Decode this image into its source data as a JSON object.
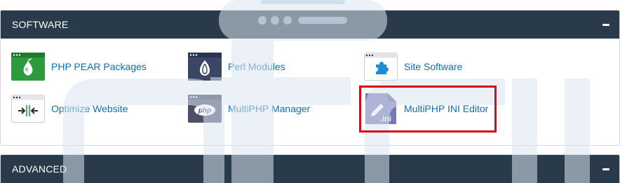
{
  "sections": {
    "software": {
      "title": "SOFTWARE",
      "items": [
        {
          "label": "PHP PEAR Packages",
          "icon": "php-pear-icon"
        },
        {
          "label": "Perl Modules",
          "icon": "perl-icon"
        },
        {
          "label": "Site Software",
          "icon": "puzzle-icon"
        },
        {
          "label": "Optimize Website",
          "icon": "compress-icon"
        },
        {
          "label": "MultiPHP Manager",
          "icon": "php-badge-icon"
        },
        {
          "label": "MultiPHP INI Editor",
          "icon": "ini-editor-icon",
          "ini_text": ".ini"
        }
      ]
    },
    "advanced": {
      "title": "ADVANCED"
    }
  },
  "php_badge_text": "php",
  "colors": {
    "header_bg": "#293a4a",
    "link": "#0e6eb8",
    "highlight": "#d40c15",
    "watermark": "#dbe6f1"
  }
}
